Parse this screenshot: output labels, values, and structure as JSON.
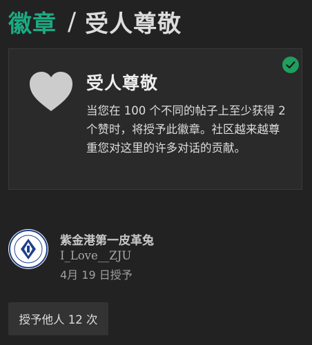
{
  "header": {
    "breadcrumb_link": "徽章",
    "separator": "/",
    "current": "受人尊敬"
  },
  "badge": {
    "icon": "heart-icon",
    "name": "受人尊敬",
    "description": "当您在 100 个不同的帖子上至少获得 2 个赞时，将授予此徽章。社区越来越尊重您对这里的许多对话的贡献。",
    "granted_icon": "checkmark-icon"
  },
  "grant": {
    "avatar_icon": "zju-logo-icon",
    "username": "紫金港第一皮革兔",
    "post_title": "I_Love__ZJU",
    "date": "4月 19 日授予"
  },
  "granted_count": "授予他人 12 次",
  "colors": {
    "accent": "#1bab83",
    "background": "#222222",
    "card": "#2a2a2a",
    "check": "#1f9e5e",
    "heart": "#cccccc"
  }
}
